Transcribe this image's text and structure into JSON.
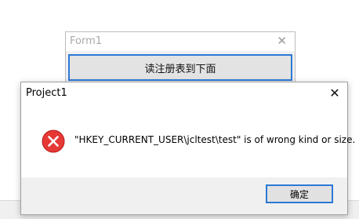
{
  "background_window": {
    "title": "Form1",
    "close_glyph": "✕",
    "button_label": "读注册表到下面"
  },
  "dialog": {
    "title": "Project1",
    "close_glyph": "✕",
    "icon": "error-icon",
    "message": "\"HKEY_CURRENT_USER\\jcltest\\test\" is of wrong kind or size.",
    "ok_label": "确定"
  },
  "colors": {
    "accent": "#2b79d6",
    "error_red": "#e53935",
    "dialog_footer": "#f0f0f0"
  }
}
